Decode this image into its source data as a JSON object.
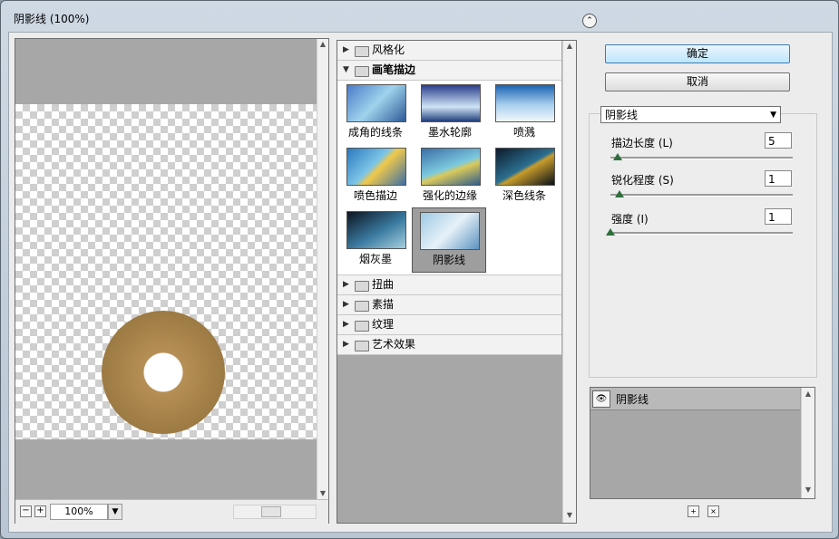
{
  "window": {
    "title": "阴影线 (100%)"
  },
  "preview": {
    "zoom_value": "100%",
    "zoom_out": "−",
    "zoom_in": "+"
  },
  "gallery": {
    "categories_top": [
      {
        "label": "风格化",
        "expanded": false
      },
      {
        "label": "画笔描边",
        "expanded": true
      }
    ],
    "filters": [
      {
        "label": "成角的线条",
        "icon": "angled-strokes-thumb",
        "selected": false
      },
      {
        "label": "墨水轮廓",
        "icon": "ink-outlines-thumb",
        "selected": false
      },
      {
        "label": "喷溅",
        "icon": "spatter-thumb",
        "selected": false
      },
      {
        "label": "喷色描边",
        "icon": "sprayed-strokes-thumb",
        "selected": false
      },
      {
        "label": "强化的边缘",
        "icon": "accented-edges-thumb",
        "selected": false
      },
      {
        "label": "深色线条",
        "icon": "dark-strokes-thumb",
        "selected": false
      },
      {
        "label": "烟灰墨",
        "icon": "sumi-e-thumb",
        "selected": false
      },
      {
        "label": "阴影线",
        "icon": "crosshatch-thumb",
        "selected": true
      }
    ],
    "categories_bottom": [
      {
        "label": "扭曲"
      },
      {
        "label": "素描"
      },
      {
        "label": "纹理"
      },
      {
        "label": "艺术效果"
      }
    ]
  },
  "actions": {
    "ok": "确定",
    "cancel": "取消"
  },
  "settings": {
    "filter_select": "阴影线",
    "params": [
      {
        "label": "描边长度 (L)",
        "value": "5",
        "level_fraction": 0.04
      },
      {
        "label": "锐化程度 (S)",
        "value": "1",
        "level_fraction": 0.05
      },
      {
        "label": "强度 (I)",
        "value": "1",
        "level_fraction": 0.0
      }
    ]
  },
  "layers": {
    "items": [
      {
        "name": "阴影线"
      }
    ]
  }
}
